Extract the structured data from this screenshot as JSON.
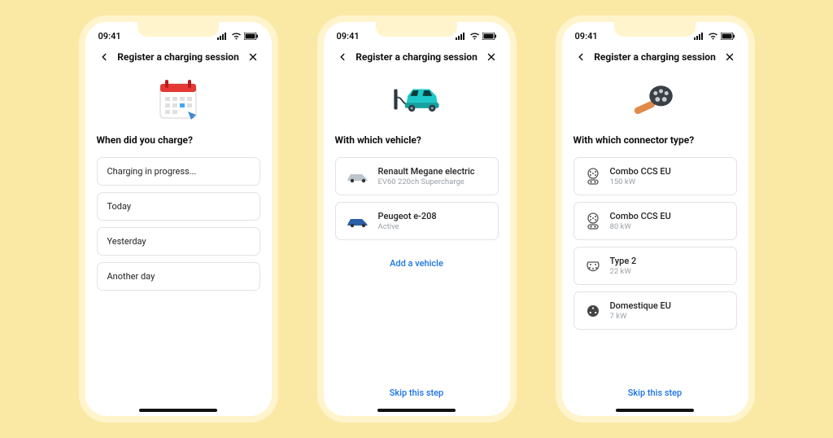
{
  "status": {
    "time": "09:41"
  },
  "nav": {
    "title": "Register a charging session"
  },
  "screen1": {
    "question": "When did you charge?",
    "options": [
      {
        "label": "Charging in progress..."
      },
      {
        "label": "Today"
      },
      {
        "label": "Yesterday"
      },
      {
        "label": "Another day"
      }
    ]
  },
  "screen2": {
    "question": "With which vehicle?",
    "vehicles": [
      {
        "title": "Renault Megane electric",
        "sub": "EV60 220ch Supercharge"
      },
      {
        "title": "Peugeot e-208",
        "sub": "Active"
      }
    ],
    "add_vehicle": "Add a vehicle",
    "skip": "Skip this step"
  },
  "screen3": {
    "question": "With which connector type?",
    "connectors": [
      {
        "title": "Combo CCS EU",
        "sub": "150 kW"
      },
      {
        "title": "Combo CCS EU",
        "sub": "80 kW"
      },
      {
        "title": "Type 2",
        "sub": "22 kW"
      },
      {
        "title": "Domestique EU",
        "sub": "7 kW"
      }
    ],
    "skip": "Skip this step"
  }
}
